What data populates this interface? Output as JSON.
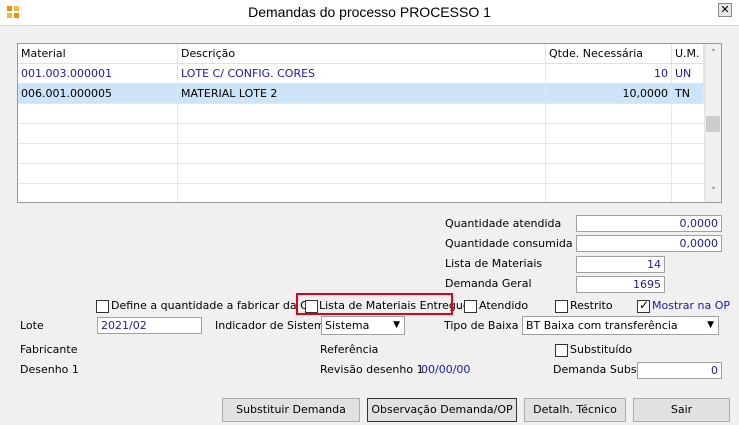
{
  "window": {
    "title": "Demandas do processo PROCESSO 1",
    "close_label": "✕"
  },
  "grid": {
    "headers": [
      "Material",
      "Descrição",
      "Qtde. Necessária",
      "U.M."
    ],
    "rows": [
      {
        "material": "001.003.000001",
        "descricao": "LOTE C/ CONFIG. CORES",
        "qtde": "10",
        "um": "UN"
      },
      {
        "material": "006.001.000005",
        "descricao": "MATERIAL LOTE 2",
        "qtde": "10,0000",
        "um": "TN"
      }
    ],
    "scroll_up": "˄",
    "scroll_down": "˅"
  },
  "summary": {
    "quantidade_atendida": {
      "label": "Quantidade atendida",
      "value": "0,0000"
    },
    "quantidade_consumida": {
      "label": "Quantidade consumida",
      "value": "0,0000"
    },
    "lista_materiais": {
      "label": "Lista de Materiais",
      "value": "14"
    },
    "demanda_geral": {
      "label": "Demanda Geral",
      "value": "1695"
    }
  },
  "checkboxes": {
    "define_quantidade": {
      "label": "Define a quantidade a fabricar da OP",
      "checked": false
    },
    "lista_entregue": {
      "label": "Lista de Materiais Entregue",
      "checked": false
    },
    "atendido": {
      "label": "Atendido",
      "checked": false
    },
    "restrito": {
      "label": "Restrito",
      "checked": false
    },
    "mostrar_op": {
      "label": "Mostrar na OP",
      "checked": true,
      "mark": "✓"
    },
    "substituido": {
      "label": "Substituído",
      "checked": false
    }
  },
  "lote": {
    "label": "Lote",
    "value": "2021/02"
  },
  "indicador": {
    "label": "Indicador de Sistema",
    "value": "Sistema"
  },
  "tipo_baixa": {
    "label": "Tipo de Baixa",
    "value": "BT Baixa com transferência"
  },
  "fabricante": {
    "label": "Fabricante"
  },
  "referencia": {
    "label": "Referência"
  },
  "desenho": {
    "label": "Desenho 1"
  },
  "revisao": {
    "label": "Revisão desenho 1",
    "value": "00/00/00"
  },
  "demanda_subst": {
    "label": "Demanda Subst.",
    "value": "0"
  },
  "buttons": {
    "substituir": "Substituir Demanda",
    "observacao": "Observação Demanda/OP",
    "detalhe": "Detalh. Técnico",
    "sair": "Sair"
  },
  "colors": {
    "highlight": "#e0001a",
    "selection": "#cce4f7",
    "value_text": "#1a1aa6"
  }
}
